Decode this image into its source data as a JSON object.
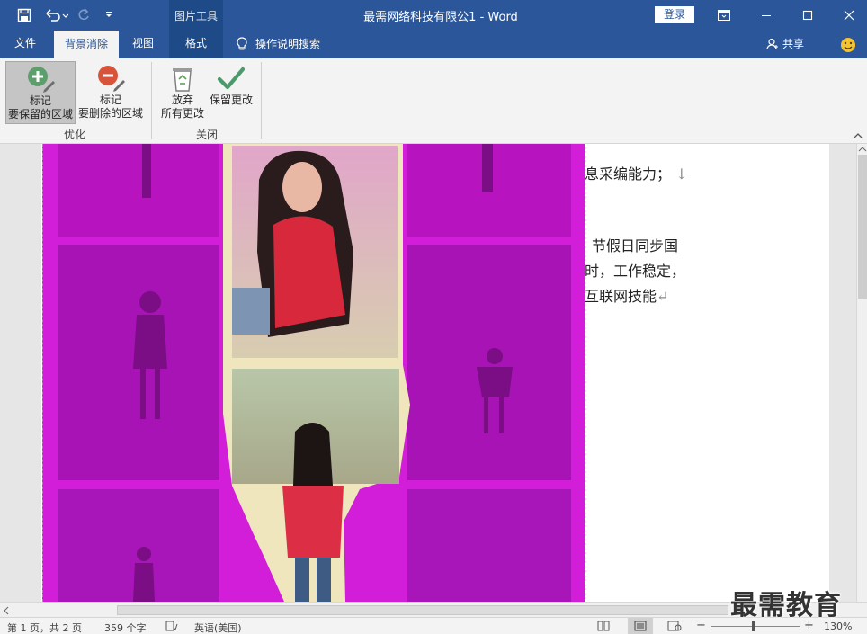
{
  "titlebar": {
    "context_group": "图片工具",
    "doc_title": "最需网络科技有限公1  -  Word",
    "login": "登录"
  },
  "tabs": [
    {
      "label": "文件"
    },
    {
      "label": "背景消除"
    },
    {
      "label": "视图"
    },
    {
      "label": "格式"
    }
  ],
  "tell_me": "操作说明搜索",
  "share": "共享",
  "ribbon": {
    "mark_keep_line1": "标记",
    "mark_keep_line2": "要保留的区域",
    "mark_remove_line1": "标记",
    "mark_remove_line2": "要删除的区域",
    "discard_line1": "放弃",
    "discard_line2": "所有更改",
    "keep_changes": "保留更改",
    "group_refine": "优化",
    "group_close": "关闭"
  },
  "document": {
    "lines": [
      "息采编能力；",
      "节假日同步国",
      "时，工作稳定，",
      "互联网技能"
    ],
    "para_mark_arrow": "↓",
    "para_mark_return": "↵"
  },
  "statusbar": {
    "page": "第 1 页，共 2 页",
    "words": "359 个字",
    "language": "英语(美国)",
    "zoom": "130%",
    "zoom_minus": "−",
    "zoom_plus": "+",
    "zoom_fraction": 0.48
  },
  "watermark": "最需教育",
  "colors": {
    "ribbon_blue": "#2b579a",
    "removal_magenta": "#d21ed8",
    "keep_green": "#5c9e6c",
    "remove_red": "#d9533b"
  }
}
